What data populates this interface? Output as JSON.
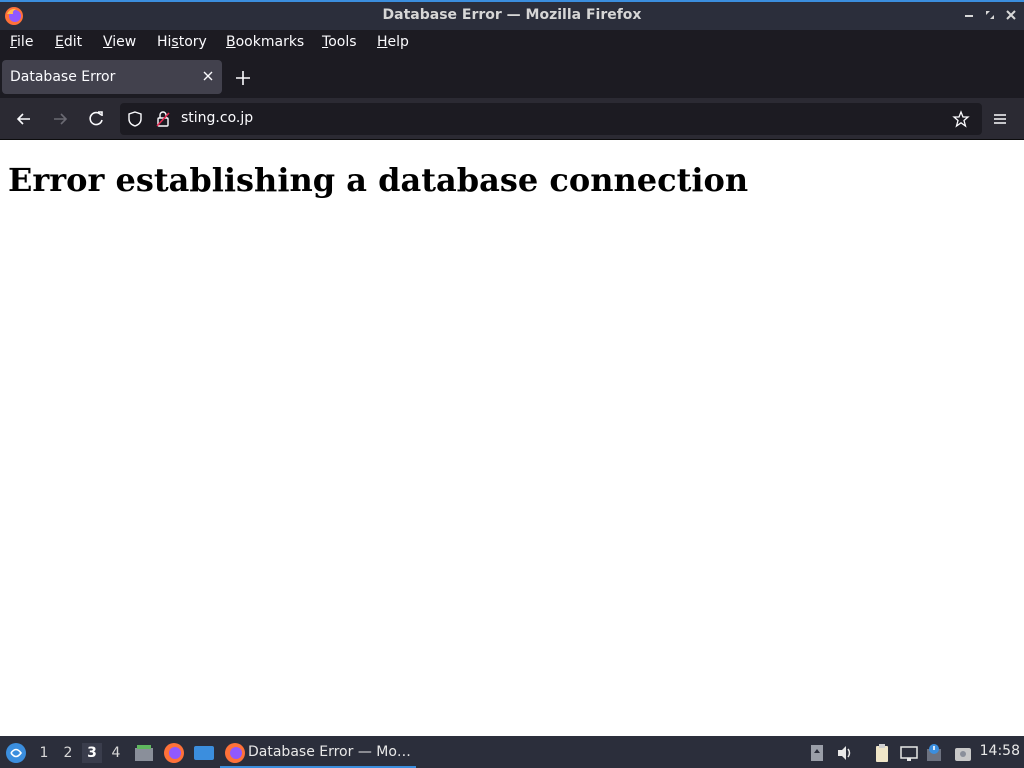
{
  "window": {
    "title": "Database Error — Mozilla Firefox"
  },
  "menu": {
    "items": [
      {
        "label": "File",
        "mnemonic": "F",
        "rest": "ile"
      },
      {
        "label": "Edit",
        "mnemonic": "E",
        "rest": "dit"
      },
      {
        "label": "View",
        "mnemonic": "V",
        "rest": "iew"
      },
      {
        "label": "History",
        "mnemonic": "s",
        "pre": "Hi",
        "rest": "tory"
      },
      {
        "label": "Bookmarks",
        "mnemonic": "B",
        "rest": "ookmarks"
      },
      {
        "label": "Tools",
        "mnemonic": "T",
        "rest": "ools"
      },
      {
        "label": "Help",
        "mnemonic": "H",
        "rest": "elp"
      }
    ]
  },
  "tabs": [
    {
      "title": "Database Error",
      "active": true
    }
  ],
  "urlbar": {
    "url": "sting.co.jp"
  },
  "page": {
    "heading": "Error establishing a database connection"
  },
  "taskbar": {
    "workspaces": [
      "1",
      "2",
      "3",
      "4"
    ],
    "active_workspace": "3",
    "task_label": "Database Error — Mo…",
    "clock": "14:58"
  },
  "colors": {
    "accent": "#3b8ede",
    "chrome_dark": "#1c1b22",
    "toolbar": "#2b2a33",
    "tab_active": "#42414d",
    "panel": "#2b2e3b"
  }
}
